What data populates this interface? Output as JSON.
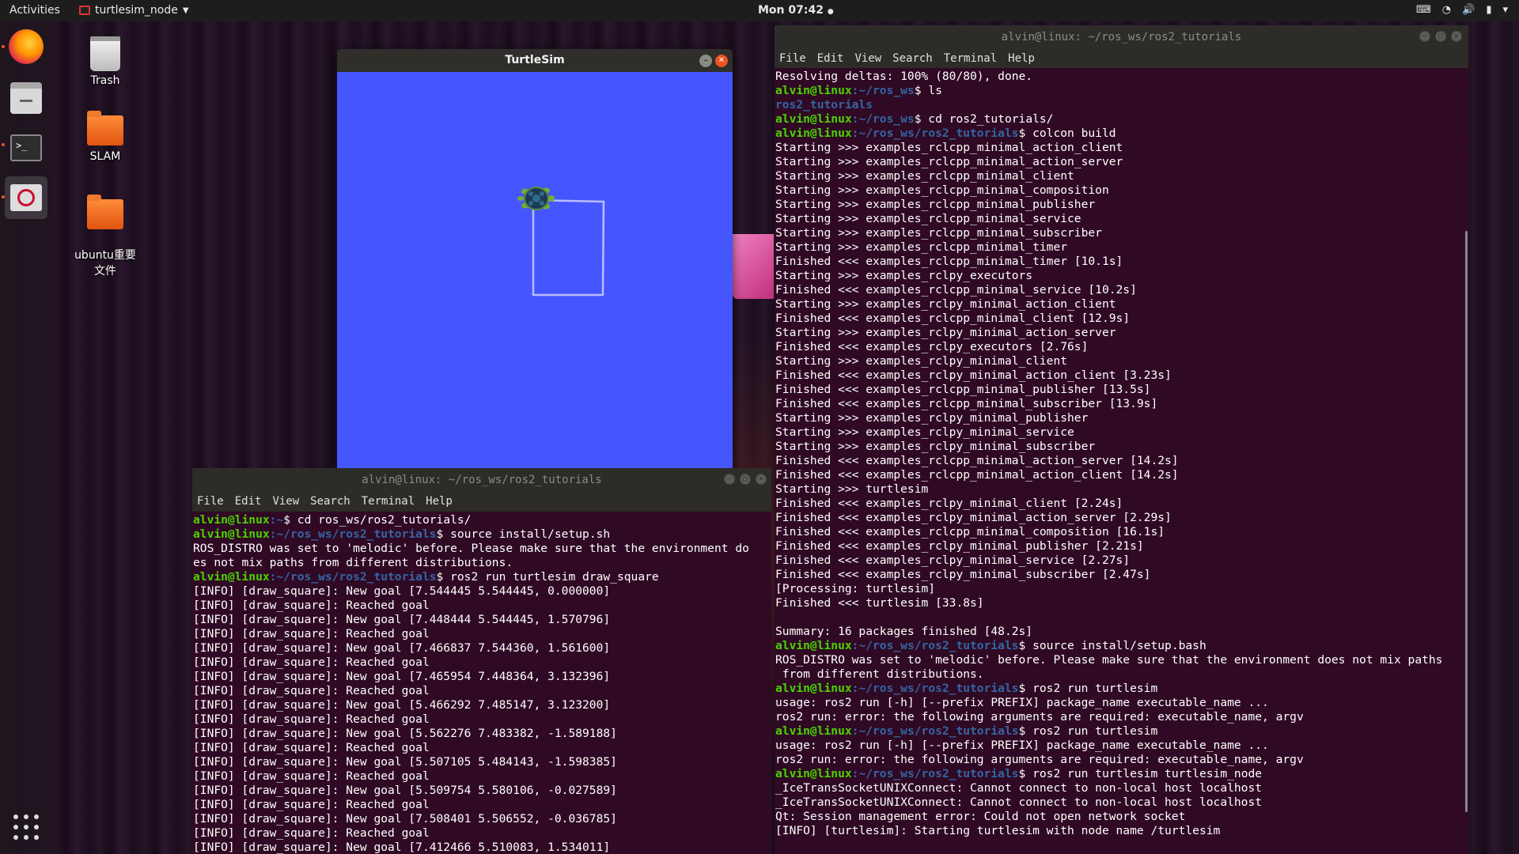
{
  "topbar": {
    "activities": "Activities",
    "app_name": "turtlesim_node",
    "clock": "Mon 07:42",
    "tray_icons": [
      "keyboard-icon",
      "wifi-icon",
      "volume-icon",
      "battery-icon",
      "power-icon"
    ]
  },
  "dock": {
    "items": [
      "firefox-icon",
      "files-icon",
      "terminal-icon",
      "turtlesim-icon"
    ],
    "show_apps": "show-applications-icon"
  },
  "desktop": {
    "icons": [
      {
        "label": "Trash"
      },
      {
        "label": "SLAM"
      },
      {
        "label": "ubuntu重要\n文件"
      }
    ]
  },
  "turtlesim_window": {
    "title": "TurtleSim",
    "background": "#4556ff"
  },
  "terminal_left": {
    "title": "alvin@linux: ~/ros_ws/ros2_tutorials",
    "menu": [
      "File",
      "Edit",
      "View",
      "Search",
      "Terminal",
      "Help"
    ],
    "lines": [
      {
        "user": "alvin@linux",
        "path": ":~",
        "cmd": "$ cd ros_ws/ros2_tutorials/"
      },
      {
        "user": "alvin@linux",
        "path": ":~/ros_ws/ros2_tutorials",
        "cmd": "$ source install/setup.sh"
      },
      {
        "text": "ROS_DISTRO was set to 'melodic' before. Please make sure that the environment do"
      },
      {
        "text": "es not mix paths from different distributions."
      },
      {
        "user": "alvin@linux",
        "path": ":~/ros_ws/ros2_tutorials",
        "cmd": "$ ros2 run turtlesim draw_square"
      },
      {
        "text": "[INFO] [draw_square]: New goal [7.544445 5.544445, 0.000000]"
      },
      {
        "text": "[INFO] [draw_square]: Reached goal"
      },
      {
        "text": "[INFO] [draw_square]: New goal [7.448444 5.544445, 1.570796]"
      },
      {
        "text": "[INFO] [draw_square]: Reached goal"
      },
      {
        "text": "[INFO] [draw_square]: New goal [7.466837 7.544360, 1.561600]"
      },
      {
        "text": "[INFO] [draw_square]: Reached goal"
      },
      {
        "text": "[INFO] [draw_square]: New goal [7.465954 7.448364, 3.132396]"
      },
      {
        "text": "[INFO] [draw_square]: Reached goal"
      },
      {
        "text": "[INFO] [draw_square]: New goal [5.466292 7.485147, 3.123200]"
      },
      {
        "text": "[INFO] [draw_square]: Reached goal"
      },
      {
        "text": "[INFO] [draw_square]: New goal [5.562276 7.483382, -1.589188]"
      },
      {
        "text": "[INFO] [draw_square]: Reached goal"
      },
      {
        "text": "[INFO] [draw_square]: New goal [5.507105 5.484143, -1.598385]"
      },
      {
        "text": "[INFO] [draw_square]: Reached goal"
      },
      {
        "text": "[INFO] [draw_square]: New goal [5.509754 5.580106, -0.027589]"
      },
      {
        "text": "[INFO] [draw_square]: Reached goal"
      },
      {
        "text": "[INFO] [draw_square]: New goal [7.508401 5.506552, -0.036785]"
      },
      {
        "text": "[INFO] [draw_square]: Reached goal"
      },
      {
        "text": "[INFO] [draw_square]: New goal [7.412466 5.510083, 1.534011]"
      }
    ]
  },
  "terminal_right": {
    "title": "alvin@linux: ~/ros_ws/ros2_tutorials",
    "menu": [
      "File",
      "Edit",
      "View",
      "Search",
      "Terminal",
      "Help"
    ],
    "lines": [
      {
        "text": "Resolving deltas: 100% (80/80), done."
      },
      {
        "user": "alvin@linux",
        "path": ":~/ros_ws",
        "cmd": "$ ls"
      },
      {
        "dir": "ros2_tutorials"
      },
      {
        "user": "alvin@linux",
        "path": ":~/ros_ws",
        "cmd": "$ cd ros2_tutorials/"
      },
      {
        "user": "alvin@linux",
        "path": ":~/ros_ws/ros2_tutorials",
        "cmd": "$ colcon build"
      },
      {
        "text": "Starting >>> examples_rclcpp_minimal_action_client"
      },
      {
        "text": "Starting >>> examples_rclcpp_minimal_action_server"
      },
      {
        "text": "Starting >>> examples_rclcpp_minimal_client"
      },
      {
        "text": "Starting >>> examples_rclcpp_minimal_composition"
      },
      {
        "text": "Starting >>> examples_rclcpp_minimal_publisher"
      },
      {
        "text": "Starting >>> examples_rclcpp_minimal_service"
      },
      {
        "text": "Starting >>> examples_rclcpp_minimal_subscriber"
      },
      {
        "text": "Starting >>> examples_rclcpp_minimal_timer"
      },
      {
        "text": "Finished <<< examples_rclcpp_minimal_timer [10.1s]"
      },
      {
        "text": "Starting >>> examples_rclpy_executors"
      },
      {
        "text": "Finished <<< examples_rclcpp_minimal_service [10.2s]"
      },
      {
        "text": "Starting >>> examples_rclpy_minimal_action_client"
      },
      {
        "text": "Finished <<< examples_rclcpp_minimal_client [12.9s]"
      },
      {
        "text": "Starting >>> examples_rclpy_minimal_action_server"
      },
      {
        "text": "Finished <<< examples_rclpy_executors [2.76s]"
      },
      {
        "text": "Starting >>> examples_rclpy_minimal_client"
      },
      {
        "text": "Finished <<< examples_rclpy_minimal_action_client [3.23s]"
      },
      {
        "text": "Finished <<< examples_rclcpp_minimal_publisher [13.5s]"
      },
      {
        "text": "Finished <<< examples_rclcpp_minimal_subscriber [13.9s]"
      },
      {
        "text": "Starting >>> examples_rclpy_minimal_publisher"
      },
      {
        "text": "Starting >>> examples_rclpy_minimal_service"
      },
      {
        "text": "Starting >>> examples_rclpy_minimal_subscriber"
      },
      {
        "text": "Finished <<< examples_rclcpp_minimal_action_server [14.2s]"
      },
      {
        "text": "Finished <<< examples_rclcpp_minimal_action_client [14.2s]"
      },
      {
        "text": "Starting >>> turtlesim"
      },
      {
        "text": "Finished <<< examples_rclpy_minimal_client [2.24s]"
      },
      {
        "text": "Finished <<< examples_rclpy_minimal_action_server [2.29s]"
      },
      {
        "text": "Finished <<< examples_rclcpp_minimal_composition [16.1s]"
      },
      {
        "text": "Finished <<< examples_rclpy_minimal_publisher [2.21s]"
      },
      {
        "text": "Finished <<< examples_rclpy_minimal_service [2.27s]"
      },
      {
        "text": "Finished <<< examples_rclpy_minimal_subscriber [2.47s]"
      },
      {
        "text": "[Processing: turtlesim]"
      },
      {
        "text": "Finished <<< turtlesim [33.8s]"
      },
      {
        "text": ""
      },
      {
        "text": "Summary: 16 packages finished [48.2s]"
      },
      {
        "user": "alvin@linux",
        "path": ":~/ros_ws/ros2_tutorials",
        "cmd": "$ source install/setup.bash"
      },
      {
        "text": "ROS_DISTRO was set to 'melodic' before. Please make sure that the environment does not mix paths"
      },
      {
        "text": " from different distributions."
      },
      {
        "user": "alvin@linux",
        "path": ":~/ros_ws/ros2_tutorials",
        "cmd": "$ ros2 run turtlesim"
      },
      {
        "text": "usage: ros2 run [-h] [--prefix PREFIX] package_name executable_name ..."
      },
      {
        "text": "ros2 run: error: the following arguments are required: executable_name, argv"
      },
      {
        "user": "alvin@linux",
        "path": ":~/ros_ws/ros2_tutorials",
        "cmd": "$ ros2 run turtlesim"
      },
      {
        "text": "usage: ros2 run [-h] [--prefix PREFIX] package_name executable_name ..."
      },
      {
        "text": "ros2 run: error: the following arguments are required: executable_name, argv"
      },
      {
        "user": "alvin@linux",
        "path": ":~/ros_ws/ros2_tutorials",
        "cmd": "$ ros2 run turtlesim turtlesim_node"
      },
      {
        "text": "_IceTransSocketUNIXConnect: Cannot connect to non-local host localhost"
      },
      {
        "text": "_IceTransSocketUNIXConnect: Cannot connect to non-local host localhost"
      },
      {
        "text": "Qt: Session management error: Could not open network socket"
      },
      {
        "text": "[INFO] [turtlesim]: Starting turtlesim with node name /turtlesim"
      }
    ]
  }
}
